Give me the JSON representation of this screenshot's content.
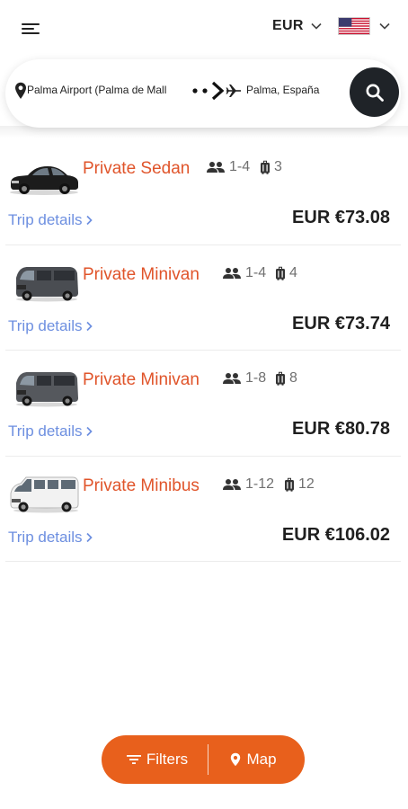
{
  "header": {
    "currency": "EUR",
    "flag_icon": "us-flag-icon"
  },
  "search": {
    "from": "Palma Airport (Palma de Mall",
    "to": "Palma, España"
  },
  "colors": {
    "accent": "#e8601c",
    "car_name": "#e0542a",
    "link": "#6d8fe0",
    "search_button": "#1f2328"
  },
  "results": [
    {
      "name": "Private Sedan",
      "passengers": "1-4",
      "luggage": "3",
      "link": "Trip details",
      "price": "EUR €73.08",
      "image": "sedan-icon"
    },
    {
      "name": "Private Minivan",
      "passengers": "1-4",
      "luggage": "4",
      "link": "Trip details",
      "price": "EUR €73.74",
      "image": "minivan-icon"
    },
    {
      "name": "Private Minivan",
      "passengers": "1-8",
      "luggage": "8",
      "link": "Trip details",
      "price": "EUR €80.78",
      "image": "minivan-icon"
    },
    {
      "name": "Private Minibus",
      "passengers": "1-12",
      "luggage": "12",
      "link": "Trip details",
      "price": "EUR €106.02",
      "image": "minibus-icon"
    }
  ],
  "bottom": {
    "filters_label": "Filters",
    "map_label": "Map"
  }
}
